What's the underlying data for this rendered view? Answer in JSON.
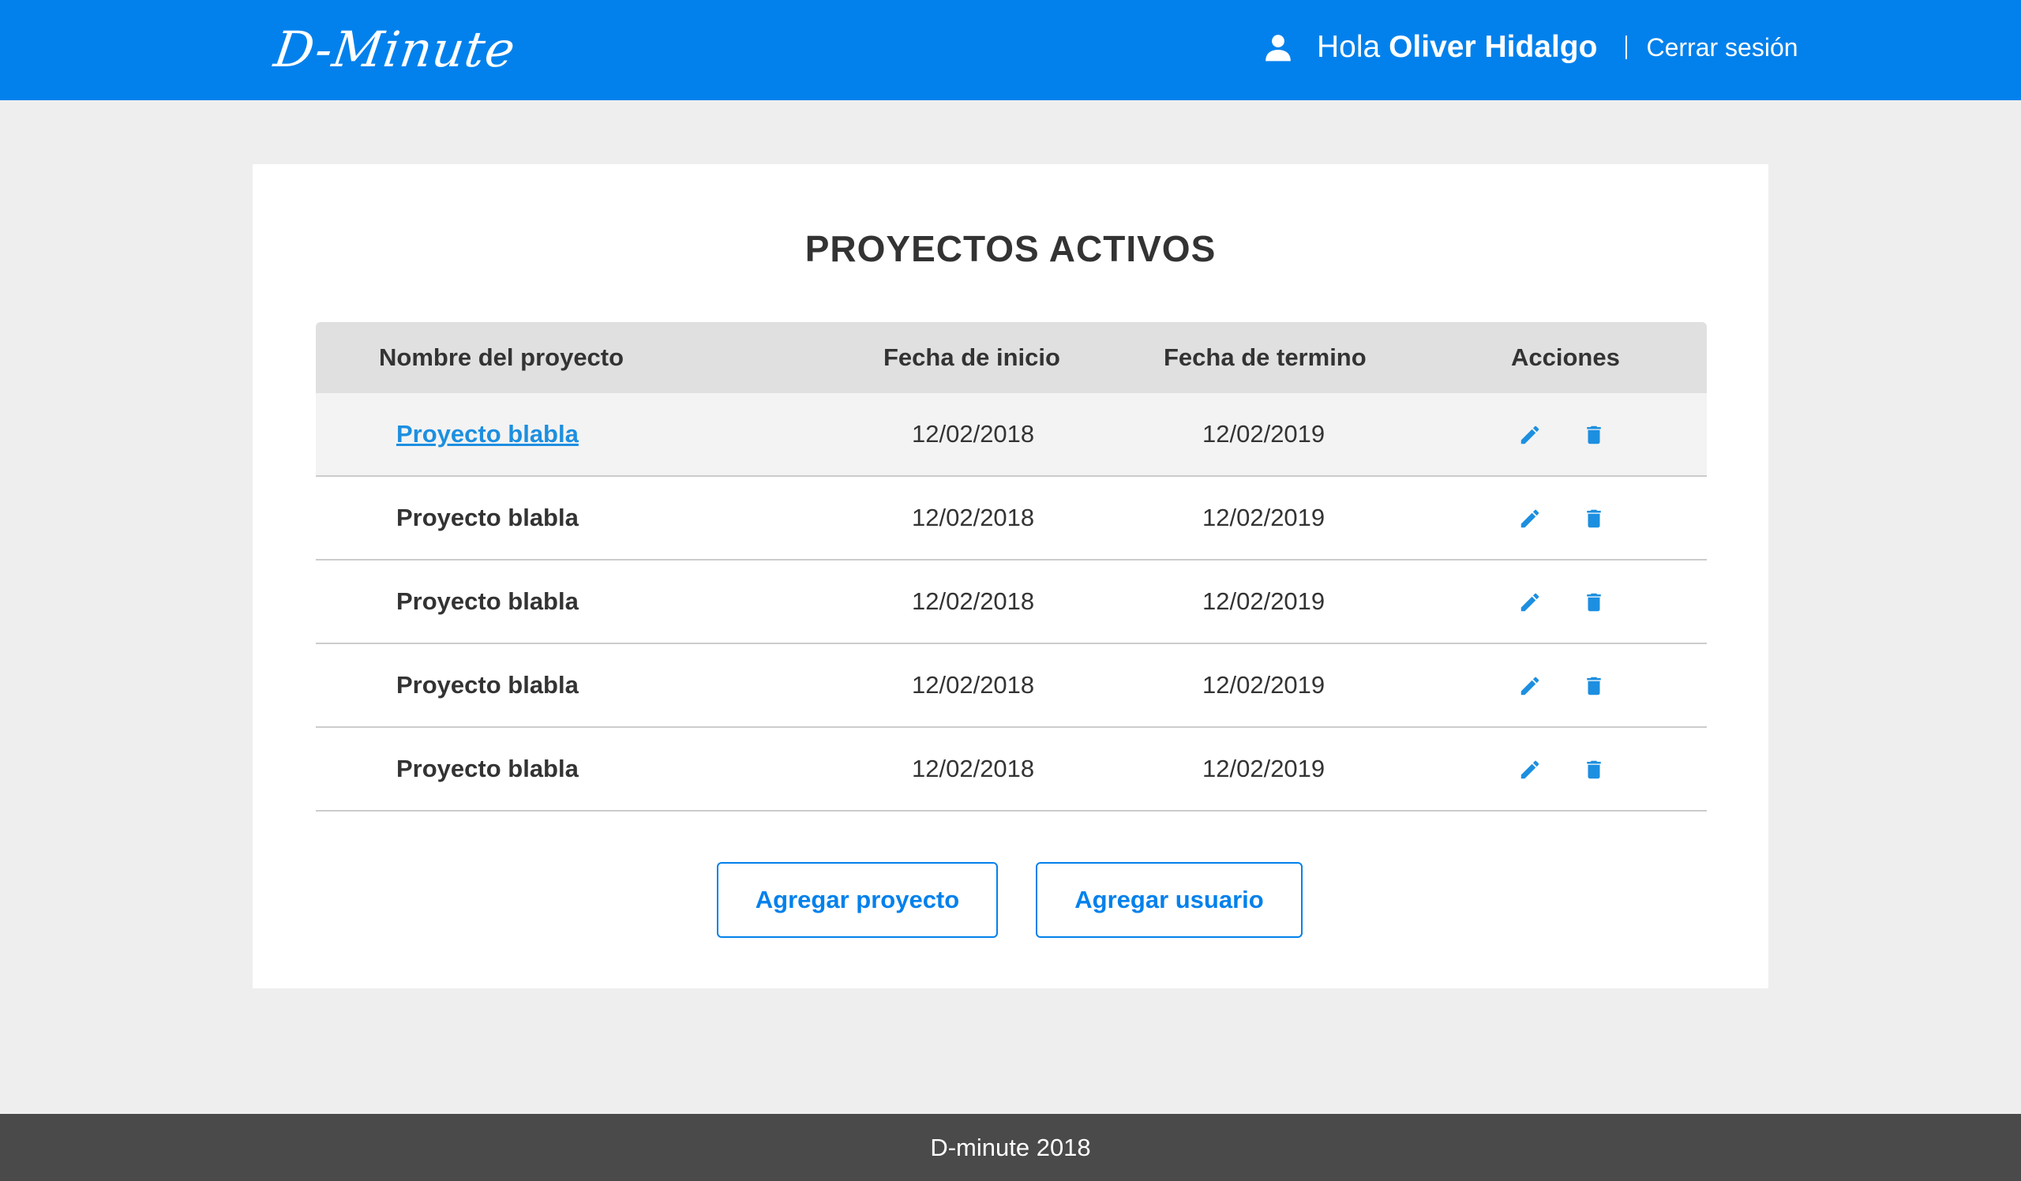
{
  "header": {
    "logo": "D-Minute",
    "greeting": "Hola",
    "user_name": "Oliver Hidalgo",
    "logout_label": "Cerrar sesión",
    "background_color": "#0281ec",
    "user_icon": "user-icon"
  },
  "main": {
    "title": "PROYECTOS ACTIVOS",
    "table": {
      "columns": [
        "Nombre del proyecto",
        "Fecha de inicio",
        "Fecha de termino",
        "Acciones"
      ],
      "rows": [
        {
          "name": "Proyecto blabla",
          "start": "12/02/2018",
          "end": "12/02/2019"
        },
        {
          "name": "Proyecto blabla",
          "start": "12/02/2018",
          "end": "12/02/2019"
        },
        {
          "name": "Proyecto blabla",
          "start": "12/02/2018",
          "end": "12/02/2019"
        },
        {
          "name": "Proyecto blabla",
          "start": "12/02/2018",
          "end": "12/02/2019"
        },
        {
          "name": "Proyecto blabla",
          "start": "12/02/2018",
          "end": "12/02/2019"
        }
      ],
      "action_icons": [
        "pencil-icon",
        "trash-icon"
      ],
      "accent_color": "#1d8fe0"
    },
    "buttons": {
      "add_project": "Agregar proyecto",
      "add_user": "Agregar usuario"
    }
  },
  "footer": {
    "text": "D-minute 2018",
    "background_color": "#4a4a4a"
  }
}
